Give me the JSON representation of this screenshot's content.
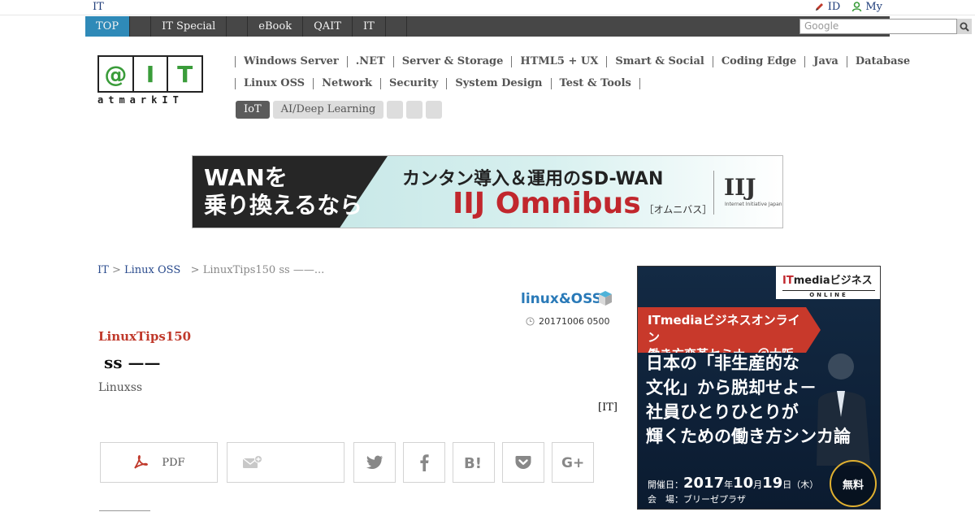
{
  "topbar": {
    "brand": "IT",
    "links": [
      {
        "label": "ID",
        "icon": "pencil-icon"
      },
      {
        "label": "My",
        "icon": "user-icon"
      }
    ]
  },
  "nav": {
    "items": [
      {
        "label": "TOP",
        "active": true
      },
      {
        "label": ""
      },
      {
        "label": "IT Special"
      },
      {
        "label": ""
      },
      {
        "label": "eBook"
      },
      {
        "label": "QAIT"
      },
      {
        "label": "IT"
      },
      {
        "label": ""
      }
    ],
    "search_placeholder": "Google",
    "search_icon": "search-icon"
  },
  "logo": {
    "letters": [
      "@",
      "I",
      "T"
    ],
    "tagline": "atmarkIT"
  },
  "categories": {
    "row1": [
      "Windows Server",
      ".NET",
      "Server & Storage",
      "HTML5 + UX",
      "Smart & Social",
      "Coding Edge",
      "Java",
      "Database"
    ],
    "row2": [
      "Linux  OSS",
      "Network",
      "Security",
      "System Design",
      "Test & Tools"
    ],
    "tags": [
      "IoT",
      "AI/Deep Learning",
      "",
      "",
      ""
    ]
  },
  "banner": {
    "left_text_1": "WANを",
    "left_text_2": "乗り換えるなら",
    "headline": "カンタン導入＆運用のSD-WAN",
    "product": "IIJ Omnibus",
    "product_sub": "［オムニバス］",
    "logo": "IIJ",
    "logo_sub": "Internet Initiative Japan"
  },
  "breadcrumb": {
    "home": "IT",
    "sep1": ">",
    "section": "Linux  OSS",
    "sep2": ">",
    "current": "LinuxTips150 ss ——..."
  },
  "article": {
    "section_logo": "linux&OSS",
    "date": "20171006 0500",
    "series": "LinuxTips150",
    "title": "ss ——",
    "subtitle": "Linuxss",
    "author": "[IT]"
  },
  "share": {
    "pdf_label": "PDF",
    "mail_label": ""
  },
  "side_ad": {
    "brand": "ITmediaビジネス",
    "brand_it": "IT",
    "brand_rest": "mediaビジネス",
    "brand_sub": "ONLINE",
    "ribbon_1": "ITmediaビジネスオンライン",
    "ribbon_2": "働き方変革セミナー＠大阪",
    "headline_1": "日本の「非生産的な",
    "headline_2": "文化」から脱却せよ－",
    "headline_3": "社員ひとりひとりが",
    "headline_4": "輝くための働き方シンカ論",
    "date_prefix": "開催日：",
    "date_year": "2017",
    "date_year_unit": "年",
    "date_month": "10",
    "date_month_unit": "月",
    "date_day": "19",
    "date_day_unit": "日（木）",
    "venue": "会　場：ブリーゼプラザ",
    "free": "無料"
  }
}
